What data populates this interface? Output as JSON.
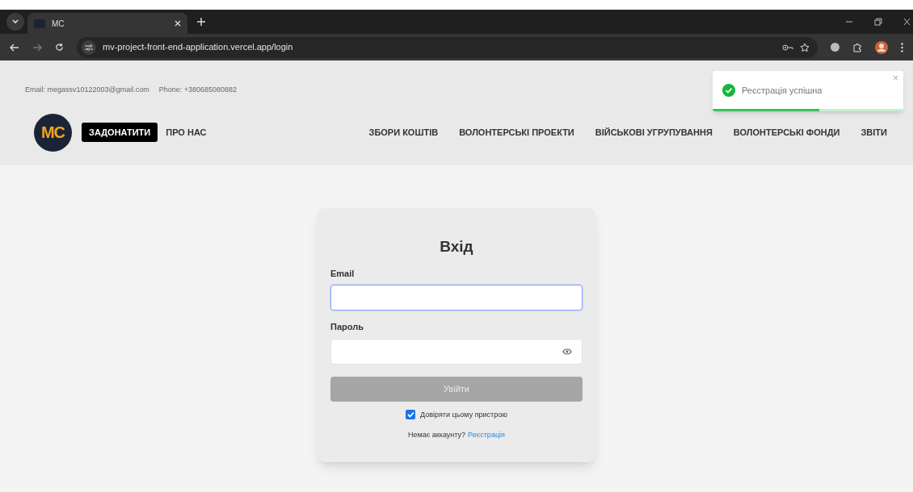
{
  "browser": {
    "tabs": [
      {
        "title": "MC",
        "selected": true
      }
    ],
    "url": "mv-project-front-end-application.vercel.app/login"
  },
  "contact": {
    "email": "Email: megassv10122003@gmail.com",
    "phone": "Phone: +380685080882"
  },
  "logo": {
    "text": "MC"
  },
  "nav": [
    {
      "label": "ЗАДОНАТИТИ",
      "kind": "primary"
    },
    {
      "label": "ПРО НАС",
      "kind": "link"
    },
    {
      "label": "ЗБОРИ КОШТІВ",
      "kind": "link"
    },
    {
      "label": "ВОЛОНТЕРСЬКІ ПРОЕКТИ",
      "kind": "link"
    },
    {
      "label": "ВІЙСЬКОВІ УГРУПУВАННЯ",
      "kind": "link"
    },
    {
      "label": "ВОЛОНТЕРСЬКІ ФОНДИ",
      "kind": "link"
    },
    {
      "label": "ЗВІТИ",
      "kind": "link"
    }
  ],
  "toast": {
    "message": "Реєстрація успішна",
    "close": "×",
    "level": 0.56
  },
  "login": {
    "title": "Вхід",
    "fields": [
      {
        "label": "Email",
        "kind": "text",
        "focused": true
      },
      {
        "label": "Пароль",
        "kind": "password",
        "focused": false
      }
    ],
    "submit": {
      "label": "Увійти",
      "disabled": true
    },
    "trust": {
      "label": "Довіряти цьому пристрою",
      "checked": true
    },
    "signup_prompt": "Немає аккаунту?",
    "signup_link": "Реєстрація"
  }
}
